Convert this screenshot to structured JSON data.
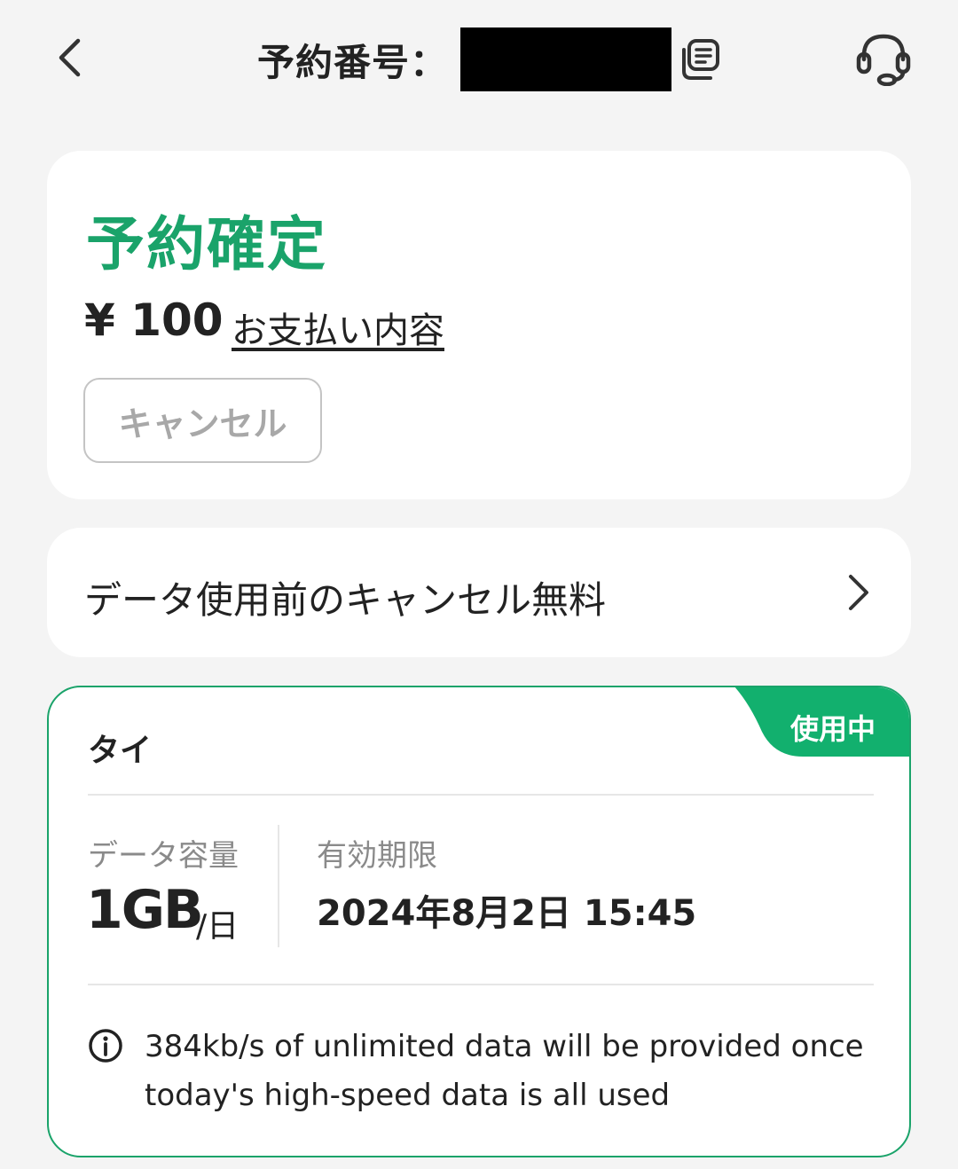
{
  "header": {
    "title": "予約番号：",
    "back_icon": "chevron-left-icon",
    "copy_icon": "copy-icon",
    "support_icon": "headset-icon"
  },
  "status_card": {
    "status": "予約確定",
    "price": "¥ 100",
    "payment_link": "お支払い内容",
    "cancel_button": "キャンセル"
  },
  "free_cancel": {
    "label": "データ使用前のキャンセル無料"
  },
  "plan": {
    "badge": "使用中",
    "country": "タイ",
    "capacity_label": "データ容量",
    "capacity_value": "1GB",
    "capacity_unit": "/日",
    "expiry_label": "有効期限",
    "expiry_value": "2024年8月2日 15:45",
    "info_text": "384kb/s of unlimited data will be provided once today's high-speed data is all used"
  },
  "colors": {
    "accent": "#1aa36a",
    "badge_bg": "#12b06e",
    "background": "#f4f4f4",
    "card": "#ffffff",
    "text": "#222222",
    "muted": "#8a8a8a"
  }
}
